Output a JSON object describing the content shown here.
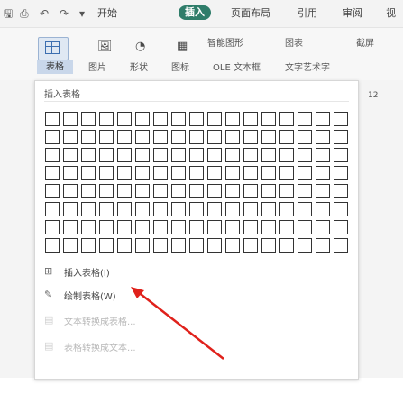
{
  "quick_access": {
    "icons": [
      "save-icon",
      "print-icon",
      "undo-icon",
      "redo-icon",
      "dropdown-icon"
    ]
  },
  "tabs": [
    {
      "label": "开始",
      "active": false
    },
    {
      "label": "插入",
      "active": true
    },
    {
      "label": "页面布局",
      "active": false
    },
    {
      "label": "引用",
      "active": false
    },
    {
      "label": "审阅",
      "active": false
    },
    {
      "label": "视",
      "active": false
    }
  ],
  "ribbon": {
    "table_label": "表格",
    "row2": [
      "图片",
      "形状",
      "图标",
      "OLE 文本框",
      "文字艺术字"
    ],
    "row1": [
      "智能图形",
      "图表",
      "截屏"
    ]
  },
  "panel": {
    "title": "插入表格",
    "grid": {
      "columns": 17,
      "rows": 8
    },
    "menu": [
      {
        "label": "插入表格(I)",
        "icon": "table-grid-icon",
        "enabled": true
      },
      {
        "label": "绘制表格(W)",
        "icon": "draw-table-icon",
        "enabled": true
      },
      {
        "label": "文本转换成表格...",
        "icon": "text-to-table-icon",
        "enabled": false
      },
      {
        "label": "表格转换成文本...",
        "icon": "table-to-text-icon",
        "enabled": false
      }
    ]
  },
  "ruler_value": "12",
  "colors": {
    "accent": "#2f7d6a",
    "annotation_arrow": "#e0211b"
  }
}
